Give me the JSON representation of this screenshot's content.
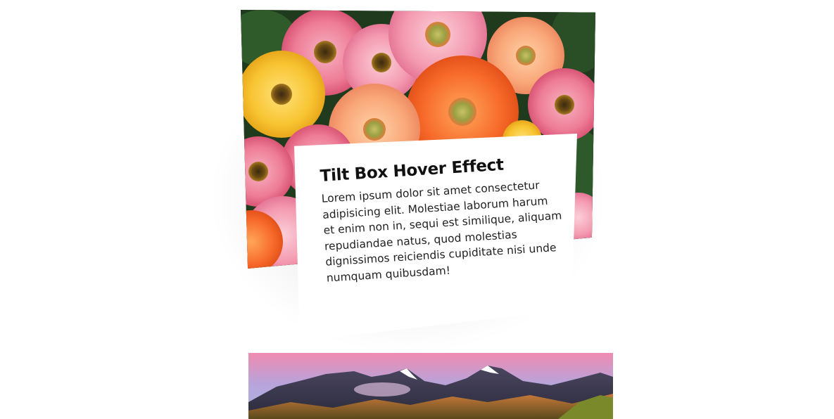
{
  "card": {
    "title": "Tilt Box Hover Effect",
    "description": "Lorem ipsum dolor sit amet consectetur adipisicing elit. Molestiae laborum harum et enim non in, sequi est similique, aliquam repudiandae natus, quod molestias dignissimos reiciendis cupiditate nisi unde numquam quibusdam!"
  },
  "images": {
    "top": "gerbera-daisies-image",
    "bottom": "mountain-sunset-image"
  },
  "colors": {
    "background": "#ffffff",
    "text": "#222222",
    "title": "#111111"
  }
}
